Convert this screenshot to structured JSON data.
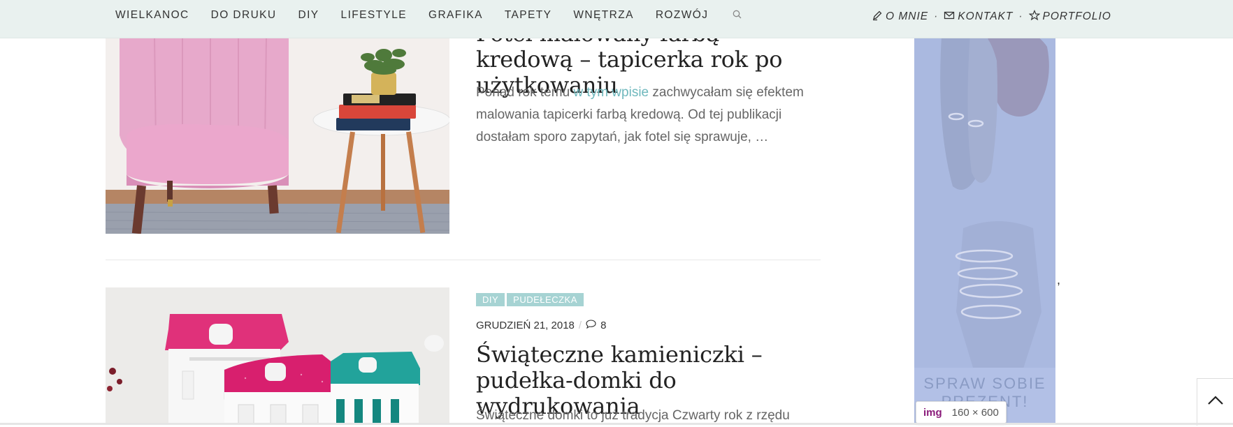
{
  "nav": {
    "items": [
      "WIELKANOC",
      "DO DRUKU",
      "DIY",
      "LIFESTYLE",
      "GRAFIKA",
      "TAPETY",
      "WNĘTRZA",
      "ROZWÓJ"
    ],
    "search_icon": "search-icon",
    "right_links": [
      {
        "label": "O MNIE",
        "icon": "pencil-icon"
      },
      {
        "label": "KONTAKT",
        "icon": "envelope-icon"
      },
      {
        "label": "PORTFOLIO",
        "icon": "star-icon"
      }
    ],
    "separator": "·"
  },
  "posts": [
    {
      "title": "Fotel malowany farbą kredową – tapicerka rok po użytkowaniu",
      "excerpt_before": "Ponad rok temu ",
      "excerpt_link": "w tym wpisie",
      "excerpt_after": " zachwycałam się efektem malowania tapicerki farbą kredową. Od tej publikacji dostałam sporo zapytań, jak fotel się sprawuje, …"
    },
    {
      "tags": [
        "DIY",
        "PUDEŁECZKA"
      ],
      "date": "GRUDZIEŃ 21, 2018",
      "separator": "/",
      "comments": "8",
      "title": "Świąteczne kamieniczki – pudełka-domki do wydrukowania",
      "excerpt": "Świąteczne domki to już tradycja Czwarty rok z rzędu"
    }
  ],
  "sidebar_ad": {
    "text": "SPRAW SOBIE PREZENT!",
    "comma": ","
  },
  "tooltip": {
    "tag": "img",
    "dims": "160 × 600"
  },
  "colors": {
    "nav_bg": "#e9f1ef",
    "accent": "#6fb8bd",
    "tag_bg": "#a6d3d3",
    "ad_overlay": "#a9b9e2"
  }
}
